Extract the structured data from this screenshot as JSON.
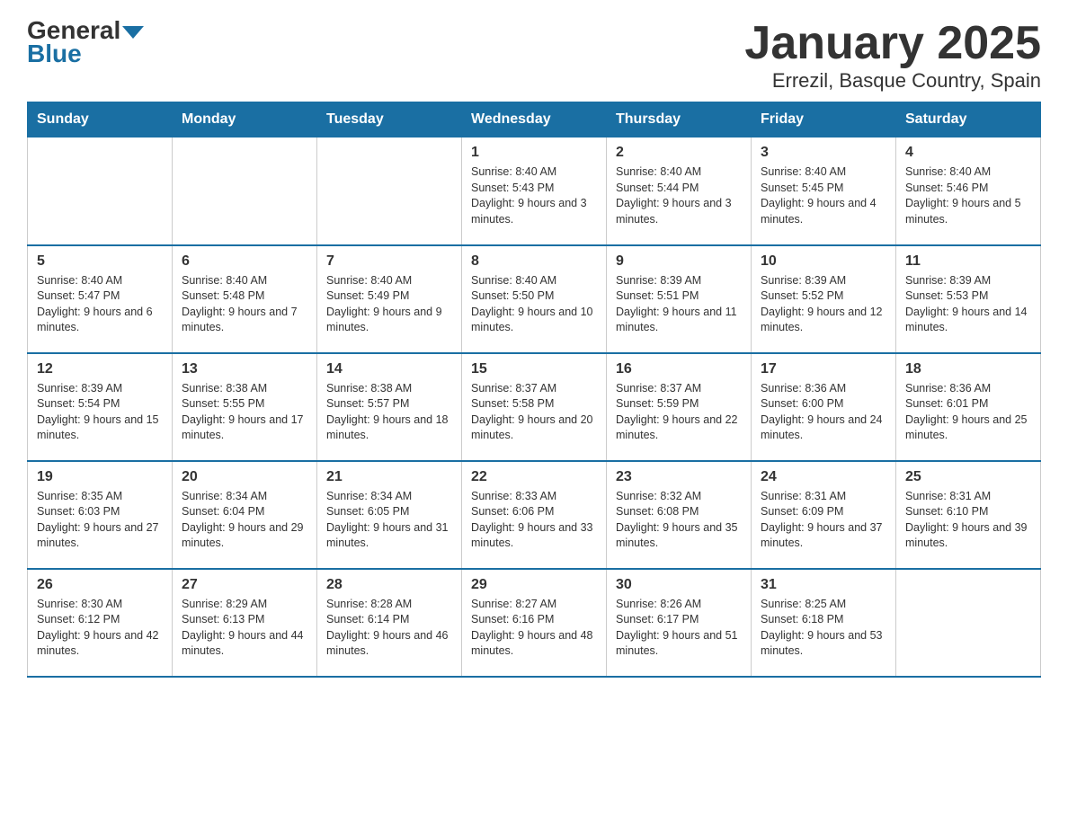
{
  "logo": {
    "general": "General",
    "blue": "Blue"
  },
  "title": "January 2025",
  "subtitle": "Errezil, Basque Country, Spain",
  "weekdays": [
    "Sunday",
    "Monday",
    "Tuesday",
    "Wednesday",
    "Thursday",
    "Friday",
    "Saturday"
  ],
  "weeks": [
    [
      {
        "day": "",
        "info": ""
      },
      {
        "day": "",
        "info": ""
      },
      {
        "day": "",
        "info": ""
      },
      {
        "day": "1",
        "info": "Sunrise: 8:40 AM\nSunset: 5:43 PM\nDaylight: 9 hours\nand 3 minutes."
      },
      {
        "day": "2",
        "info": "Sunrise: 8:40 AM\nSunset: 5:44 PM\nDaylight: 9 hours\nand 3 minutes."
      },
      {
        "day": "3",
        "info": "Sunrise: 8:40 AM\nSunset: 5:45 PM\nDaylight: 9 hours\nand 4 minutes."
      },
      {
        "day": "4",
        "info": "Sunrise: 8:40 AM\nSunset: 5:46 PM\nDaylight: 9 hours\nand 5 minutes."
      }
    ],
    [
      {
        "day": "5",
        "info": "Sunrise: 8:40 AM\nSunset: 5:47 PM\nDaylight: 9 hours\nand 6 minutes."
      },
      {
        "day": "6",
        "info": "Sunrise: 8:40 AM\nSunset: 5:48 PM\nDaylight: 9 hours\nand 7 minutes."
      },
      {
        "day": "7",
        "info": "Sunrise: 8:40 AM\nSunset: 5:49 PM\nDaylight: 9 hours\nand 9 minutes."
      },
      {
        "day": "8",
        "info": "Sunrise: 8:40 AM\nSunset: 5:50 PM\nDaylight: 9 hours\nand 10 minutes."
      },
      {
        "day": "9",
        "info": "Sunrise: 8:39 AM\nSunset: 5:51 PM\nDaylight: 9 hours\nand 11 minutes."
      },
      {
        "day": "10",
        "info": "Sunrise: 8:39 AM\nSunset: 5:52 PM\nDaylight: 9 hours\nand 12 minutes."
      },
      {
        "day": "11",
        "info": "Sunrise: 8:39 AM\nSunset: 5:53 PM\nDaylight: 9 hours\nand 14 minutes."
      }
    ],
    [
      {
        "day": "12",
        "info": "Sunrise: 8:39 AM\nSunset: 5:54 PM\nDaylight: 9 hours\nand 15 minutes."
      },
      {
        "day": "13",
        "info": "Sunrise: 8:38 AM\nSunset: 5:55 PM\nDaylight: 9 hours\nand 17 minutes."
      },
      {
        "day": "14",
        "info": "Sunrise: 8:38 AM\nSunset: 5:57 PM\nDaylight: 9 hours\nand 18 minutes."
      },
      {
        "day": "15",
        "info": "Sunrise: 8:37 AM\nSunset: 5:58 PM\nDaylight: 9 hours\nand 20 minutes."
      },
      {
        "day": "16",
        "info": "Sunrise: 8:37 AM\nSunset: 5:59 PM\nDaylight: 9 hours\nand 22 minutes."
      },
      {
        "day": "17",
        "info": "Sunrise: 8:36 AM\nSunset: 6:00 PM\nDaylight: 9 hours\nand 24 minutes."
      },
      {
        "day": "18",
        "info": "Sunrise: 8:36 AM\nSunset: 6:01 PM\nDaylight: 9 hours\nand 25 minutes."
      }
    ],
    [
      {
        "day": "19",
        "info": "Sunrise: 8:35 AM\nSunset: 6:03 PM\nDaylight: 9 hours\nand 27 minutes."
      },
      {
        "day": "20",
        "info": "Sunrise: 8:34 AM\nSunset: 6:04 PM\nDaylight: 9 hours\nand 29 minutes."
      },
      {
        "day": "21",
        "info": "Sunrise: 8:34 AM\nSunset: 6:05 PM\nDaylight: 9 hours\nand 31 minutes."
      },
      {
        "day": "22",
        "info": "Sunrise: 8:33 AM\nSunset: 6:06 PM\nDaylight: 9 hours\nand 33 minutes."
      },
      {
        "day": "23",
        "info": "Sunrise: 8:32 AM\nSunset: 6:08 PM\nDaylight: 9 hours\nand 35 minutes."
      },
      {
        "day": "24",
        "info": "Sunrise: 8:31 AM\nSunset: 6:09 PM\nDaylight: 9 hours\nand 37 minutes."
      },
      {
        "day": "25",
        "info": "Sunrise: 8:31 AM\nSunset: 6:10 PM\nDaylight: 9 hours\nand 39 minutes."
      }
    ],
    [
      {
        "day": "26",
        "info": "Sunrise: 8:30 AM\nSunset: 6:12 PM\nDaylight: 9 hours\nand 42 minutes."
      },
      {
        "day": "27",
        "info": "Sunrise: 8:29 AM\nSunset: 6:13 PM\nDaylight: 9 hours\nand 44 minutes."
      },
      {
        "day": "28",
        "info": "Sunrise: 8:28 AM\nSunset: 6:14 PM\nDaylight: 9 hours\nand 46 minutes."
      },
      {
        "day": "29",
        "info": "Sunrise: 8:27 AM\nSunset: 6:16 PM\nDaylight: 9 hours\nand 48 minutes."
      },
      {
        "day": "30",
        "info": "Sunrise: 8:26 AM\nSunset: 6:17 PM\nDaylight: 9 hours\nand 51 minutes."
      },
      {
        "day": "31",
        "info": "Sunrise: 8:25 AM\nSunset: 6:18 PM\nDaylight: 9 hours\nand 53 minutes."
      },
      {
        "day": "",
        "info": ""
      }
    ]
  ]
}
